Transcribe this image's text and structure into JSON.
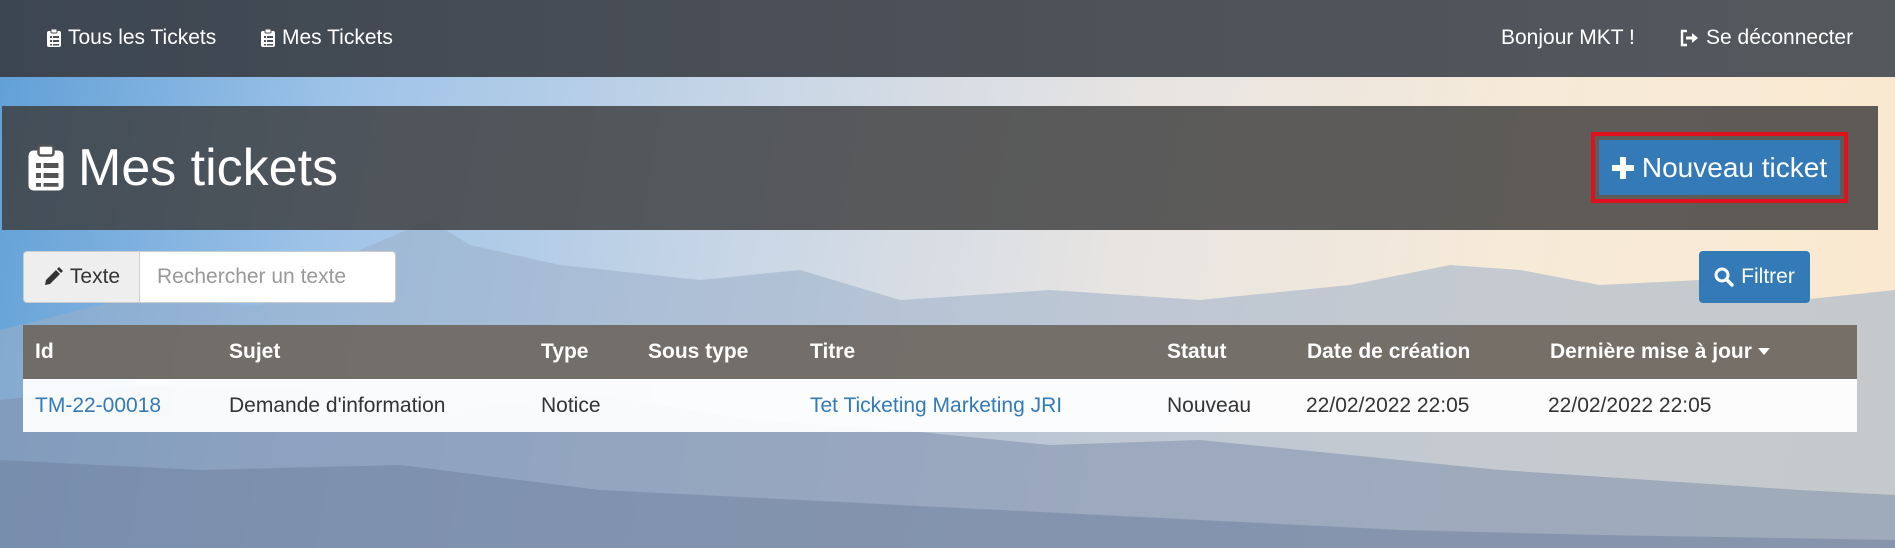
{
  "nav": {
    "all_tickets": "Tous les Tickets",
    "my_tickets": "Mes Tickets",
    "greeting": "Bonjour MKT !",
    "logout": "Se déconnecter"
  },
  "page": {
    "title": "Mes tickets",
    "new_ticket_label": "Nouveau ticket"
  },
  "search": {
    "addon_label": "Texte",
    "placeholder": "Rechercher un texte",
    "value": ""
  },
  "filter": {
    "label": "Filtrer"
  },
  "table": {
    "columns": [
      "Id",
      "Sujet",
      "Type",
      "Sous type",
      "Titre",
      "Statut",
      "Date de création",
      "Dernière mise à jour"
    ],
    "sorted_column": "Dernière mise à jour",
    "sort_direction": "desc",
    "rows": [
      {
        "id": "TM-22-00018",
        "sujet": "Demande d'information",
        "type": "Notice",
        "sous_type": "",
        "titre": "Tet Ticketing Marketing JRI",
        "statut": "Nouveau",
        "date_creation": "22/02/2022 22:05",
        "derniere_maj": "22/02/2022 22:05"
      }
    ]
  },
  "icons": {
    "nav_ticket": "clipboard-list-icon",
    "logout": "sign-out-icon",
    "title": "clipboard-list-icon",
    "new_ticket": "plus-icon",
    "search_addon": "pencil-icon",
    "filter": "search-icon",
    "sort": "caret-down-icon"
  },
  "colors": {
    "primary": "#337ab7",
    "highlight_border": "#e0101e",
    "topbar": "#4a4f57"
  }
}
